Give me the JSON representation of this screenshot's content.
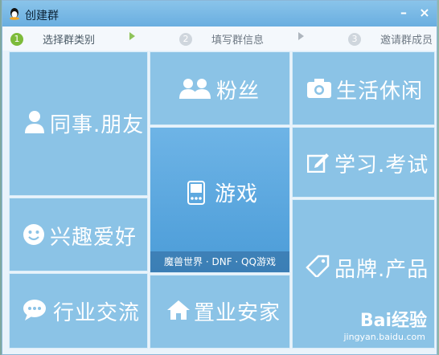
{
  "window": {
    "title": "创建群",
    "min_label": "–",
    "close_label": "×"
  },
  "steps": [
    {
      "num": "1",
      "label": "选择群类别"
    },
    {
      "num": "2",
      "label": "填写群信息"
    },
    {
      "num": "3",
      "label": "邀请群成员"
    }
  ],
  "tiles": {
    "colleagues": "同事.朋友",
    "fans": "粉丝",
    "life": "生活休闲",
    "games": "游戏",
    "games_sub": "魔兽世界 · DNF · QQ游戏",
    "study": "学习.考试",
    "hobbies": "兴趣爱好",
    "brands": "品牌.产品",
    "industry": "行业交流",
    "property": "置业安家"
  },
  "watermark": {
    "brand": "Bai经验",
    "url": "jingyan.baidu.com"
  },
  "colors": {
    "tile": "#8bc3e6",
    "active_tile": "#4b9cd8",
    "step_active": "#7dbb3a"
  }
}
